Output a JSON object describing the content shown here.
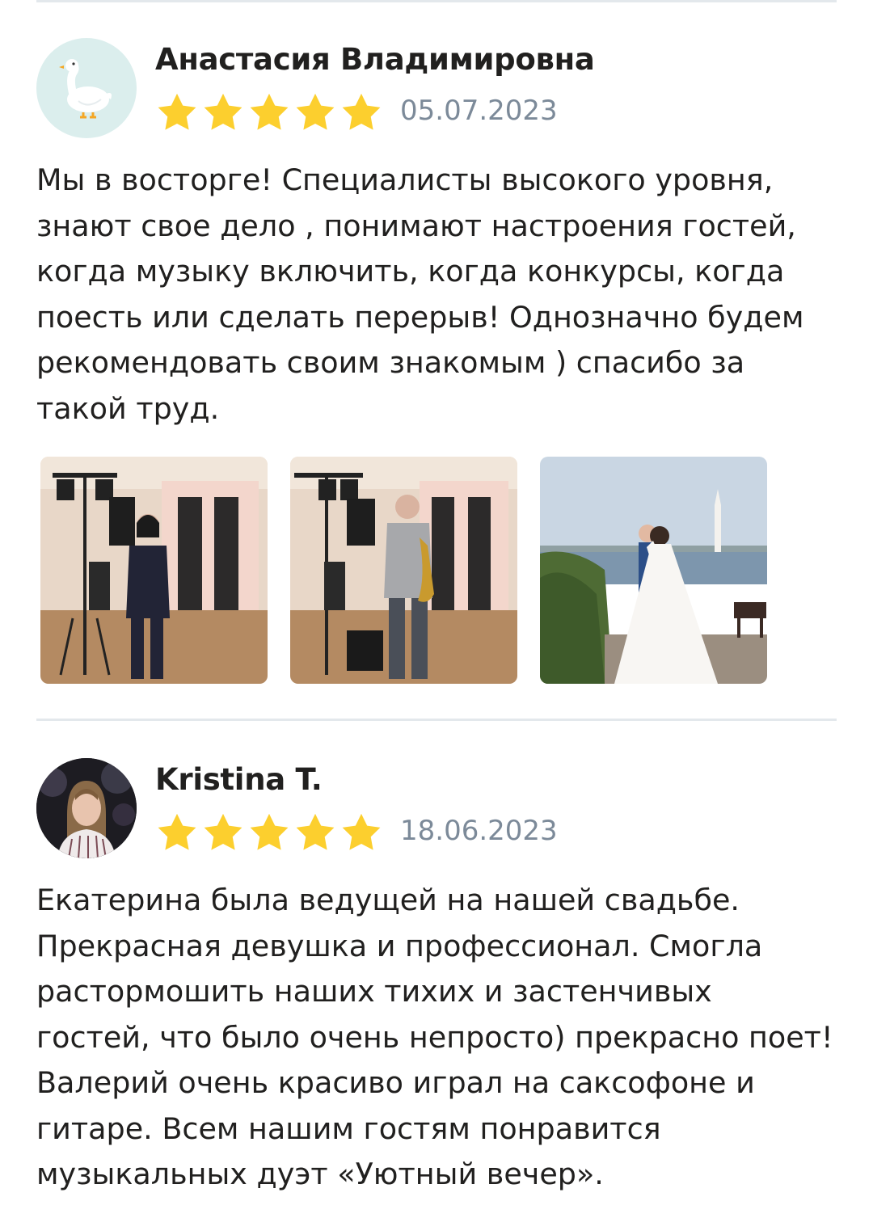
{
  "reviews": [
    {
      "author": "Анастасия Владимировна",
      "avatar_icon": "goose-icon",
      "rating": 5,
      "date": "05.07.2023",
      "text": "Мы в восторге! Специалисты высокого уровня,\nзнают свое дело , понимают настроения гостей,\nкогда музыку включить, когда конкурсы, когда\nпоесть или сделать перерыв! Однозначно будем\nрекомендовать своим знакомым ) спасибо за\nтакой труд."
    },
    {
      "author": "Kristina T.",
      "rating": 5,
      "date": "18.06.2023",
      "text": "Екатерина была ведущей на нашей свадьбе.\nПрекрасная девушка и профессионал. Смогла\nрастормошить наших тихих и застенчивых\nгостей, что было очень непросто) прекрасно поет!\nВалерий очень красиво играл на саксофоне и\nгитаре. Всем нашим гостям понравится\nмузыкальных дуэт «Уютный вечер»."
    }
  ],
  "colors": {
    "star": "#fccf2e",
    "date": "#7c8a99",
    "divider": "#e3e8ec",
    "avatar_bg": "#dbeeed"
  }
}
